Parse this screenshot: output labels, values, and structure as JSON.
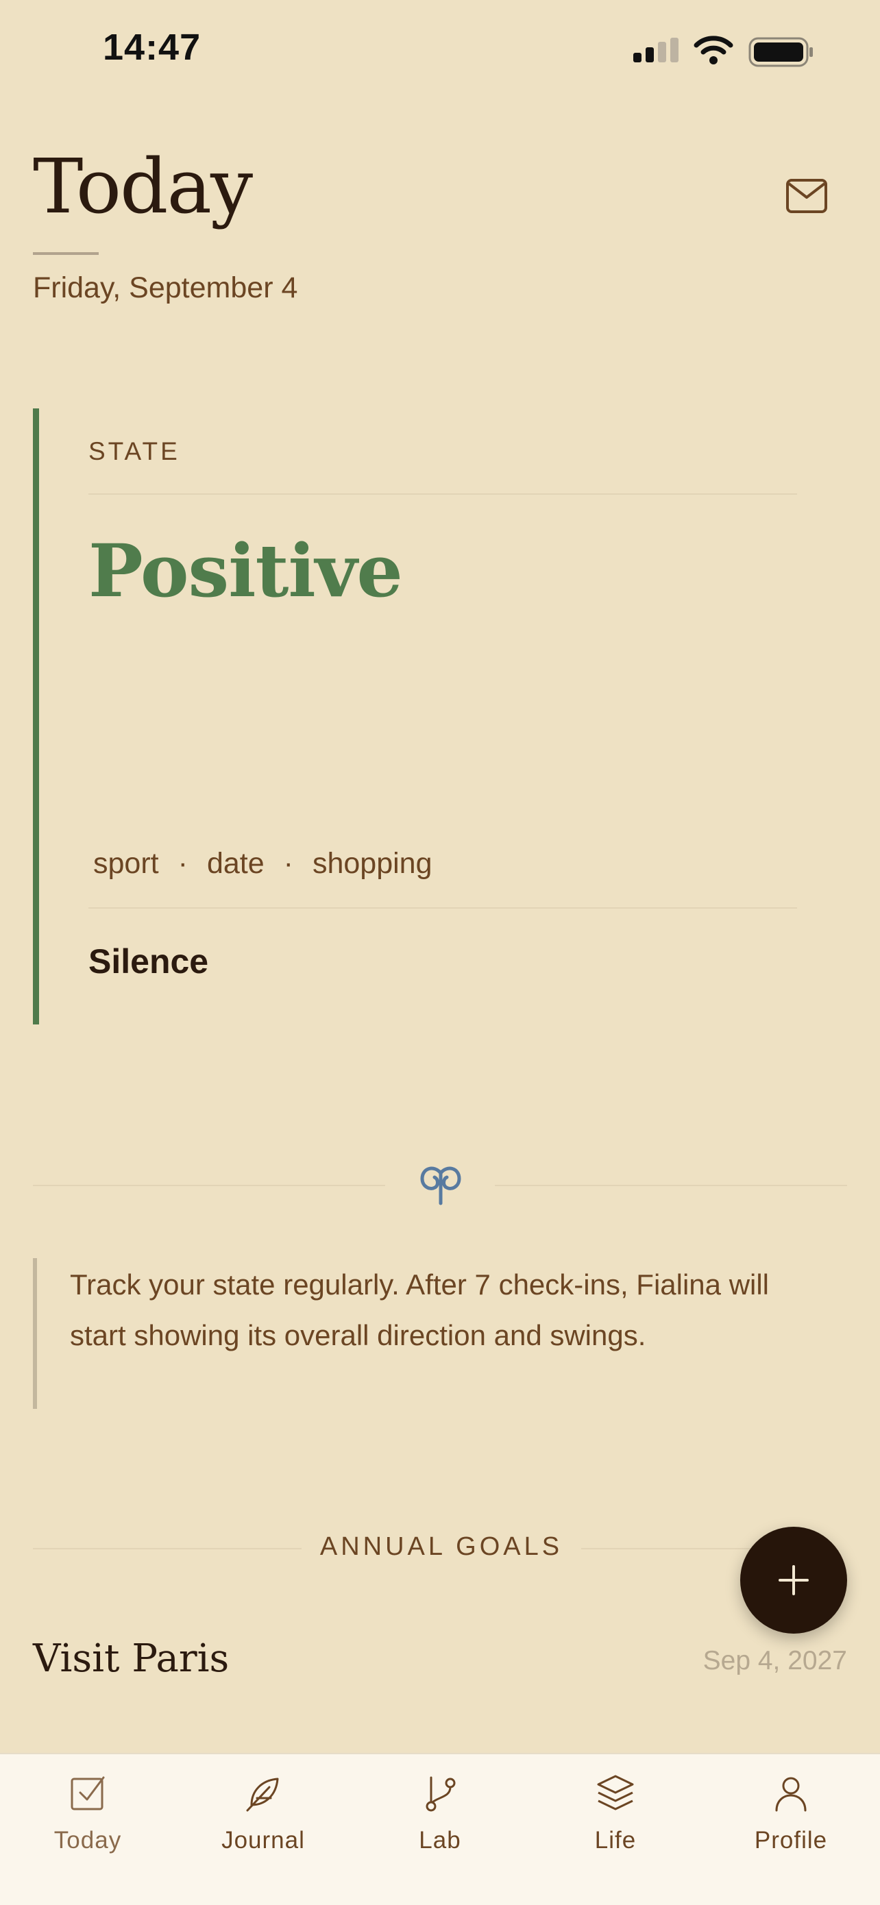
{
  "status_bar": {
    "time": "14:47"
  },
  "header": {
    "title": "Today",
    "date": "Friday, September 4"
  },
  "state_card": {
    "label": "STATE",
    "value": "Positive",
    "tags": [
      "sport",
      "date",
      "shopping"
    ],
    "tag_separator": "·",
    "note": "Silence"
  },
  "insight": {
    "text": "Track your state regularly. After 7 check-ins, Fialina will start showing its overall direction and swings."
  },
  "annual_goals": {
    "title": "ANNUAL GOALS",
    "items": [
      {
        "name": "Visit Paris",
        "date": "Sep 4, 2027"
      }
    ]
  },
  "tabbar": {
    "items": [
      {
        "label": "Today",
        "icon": "checkbox-icon"
      },
      {
        "label": "Journal",
        "icon": "feather-icon"
      },
      {
        "label": "Lab",
        "icon": "branch-icon"
      },
      {
        "label": "Life",
        "icon": "layers-icon"
      },
      {
        "label": "Profile",
        "icon": "user-icon"
      }
    ]
  },
  "colors": {
    "background": "#eee1c3",
    "accent_green": "#507c4c",
    "text_brown": "#6b4523",
    "fab": "#26150a",
    "ornament_blue": "#587aa0"
  }
}
